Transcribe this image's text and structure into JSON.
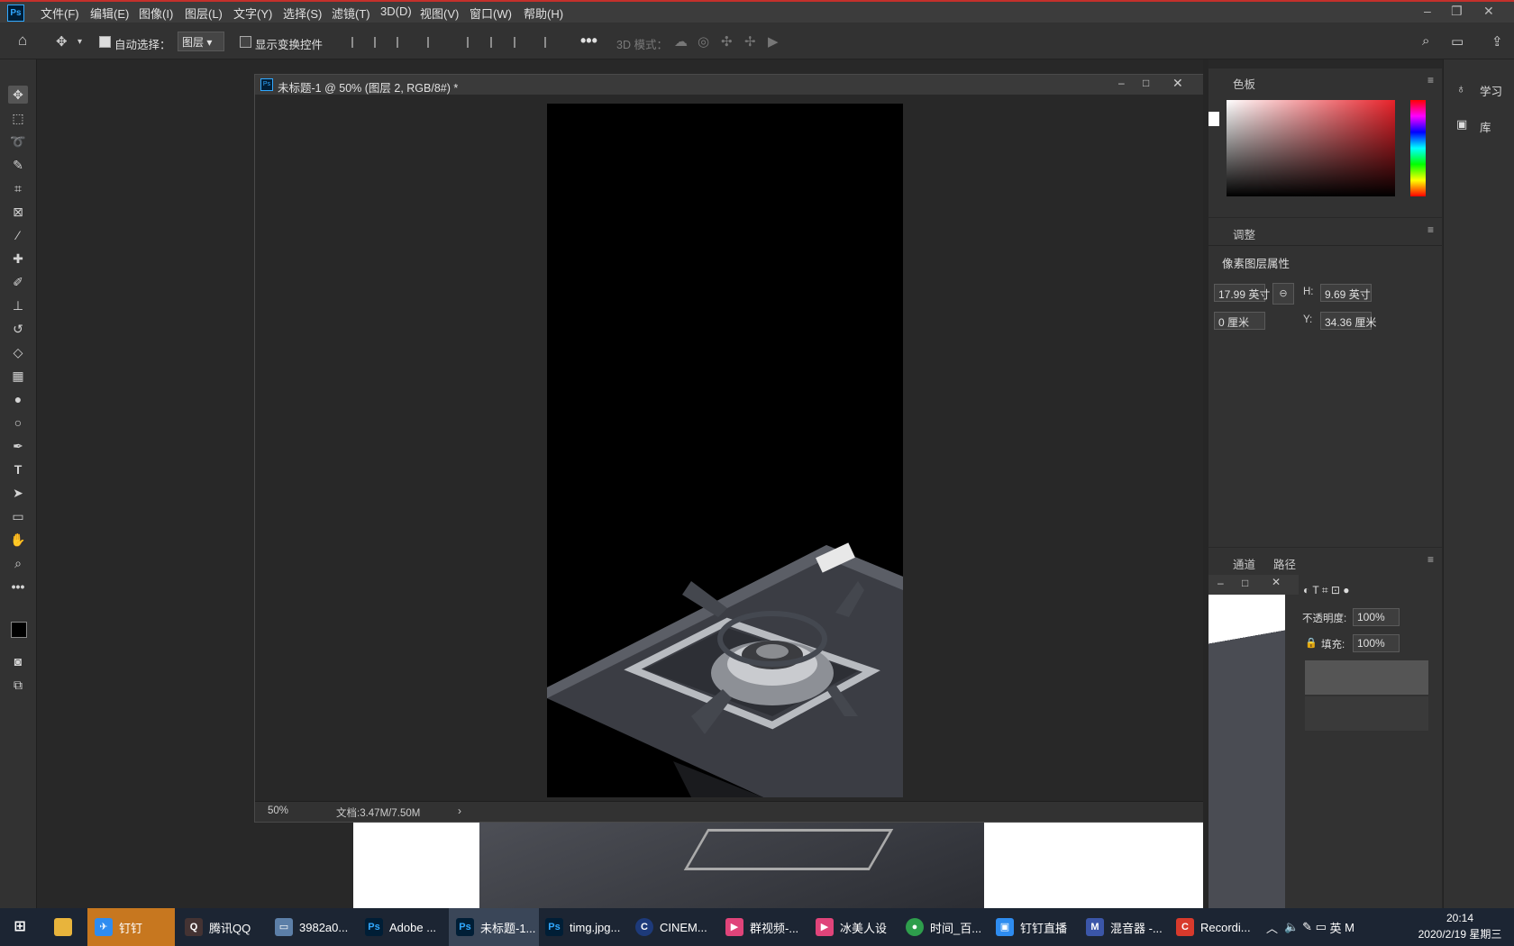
{
  "menubar": {
    "logo": "Ps",
    "items": [
      "文件(F)",
      "编辑(E)",
      "图像(I)",
      "图层(L)",
      "文字(Y)",
      "选择(S)",
      "滤镜(T)",
      "3D(D)",
      "视图(V)",
      "窗口(W)",
      "帮助(H)"
    ]
  },
  "options": {
    "auto_select_label": "自动选择：",
    "auto_select_value": "图层",
    "show_transform_label": "显示变换控件",
    "mode_3d_label": "3D 模式："
  },
  "document": {
    "title": "未标题-1 @ 50% (图层 2, RGB/8#) *",
    "zoom": "50%",
    "doc_size": "文档:3.47M/7.50M"
  },
  "panels": {
    "color_tab": "色板",
    "adjust_tab": "调整",
    "pixel_layer_props": "像素图层属性",
    "w_value": "17.99 英寸",
    "h_label": "H:",
    "h_value": "9.69 英寸",
    "x_value": "0 厘米",
    "y_label": "Y:",
    "y_value": "34.36 厘米",
    "channels_tab": "通道",
    "paths_tab": "路径",
    "opacity_label": "不透明度:",
    "opacity_value": "100%",
    "fill_label": "填充:",
    "fill_value": "100%",
    "learn_label": "学习",
    "library_label": "库"
  },
  "taskbar": {
    "items": [
      "钉钉",
      "腾讯QQ",
      "3982a0...",
      "Adobe ...",
      "未标题-1...",
      "timg.jpg...",
      "CINEM...",
      "群视频-...",
      "冰美人设",
      "时间_百...",
      "钉钉直播",
      "混音器 -...",
      "Recordi..."
    ],
    "time": "20:14",
    "date": "2020/2/19 星期三",
    "ime": "英"
  },
  "colors": {
    "accent": "#31a8ff",
    "bg": "#282828",
    "panel": "#323232"
  }
}
